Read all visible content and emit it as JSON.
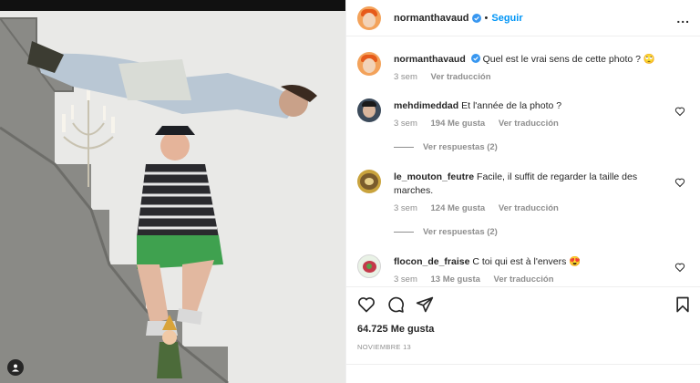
{
  "post": {
    "username": "normanthavaud",
    "follow_label": "Seguir",
    "dot": "•",
    "more_label": "..."
  },
  "caption": {
    "username": "normanthavaud",
    "text": "Quel est le vrai sens de cette photo ? 🙄",
    "time": "3 sem",
    "see_translation": "Ver traducción"
  },
  "comments": [
    {
      "username": "mehdimeddad",
      "text": "Et l'année de la photo ?",
      "time": "3 sem",
      "likes": "194 Me gusta",
      "translate": "Ver traducción",
      "replies": "Ver respuestas (2)"
    },
    {
      "username": "le_mouton_feutre",
      "text": "Facile, il suffit de regarder la taille des marches.",
      "time": "3 sem",
      "likes": "124 Me gusta",
      "translate": "Ver traducción",
      "replies": "Ver respuestas (2)"
    },
    {
      "username": "flocon_de_fraise",
      "text": "C toi qui est à l'envers 😍",
      "time": "3 sem",
      "likes": "13 Me gusta",
      "translate": "Ver traducción"
    }
  ],
  "footer": {
    "likes": "64.725 Me gusta",
    "date": "NOVIEMBRE 13"
  },
  "colors": {
    "accent": "#0095f6",
    "muted": "#8e8e8e",
    "text": "#262626",
    "verified": "#3897f0"
  },
  "icons": [
    "heart-icon",
    "comment-icon",
    "share-icon",
    "bookmark-icon",
    "verified-icon",
    "more-icon",
    "tag-user-icon"
  ]
}
